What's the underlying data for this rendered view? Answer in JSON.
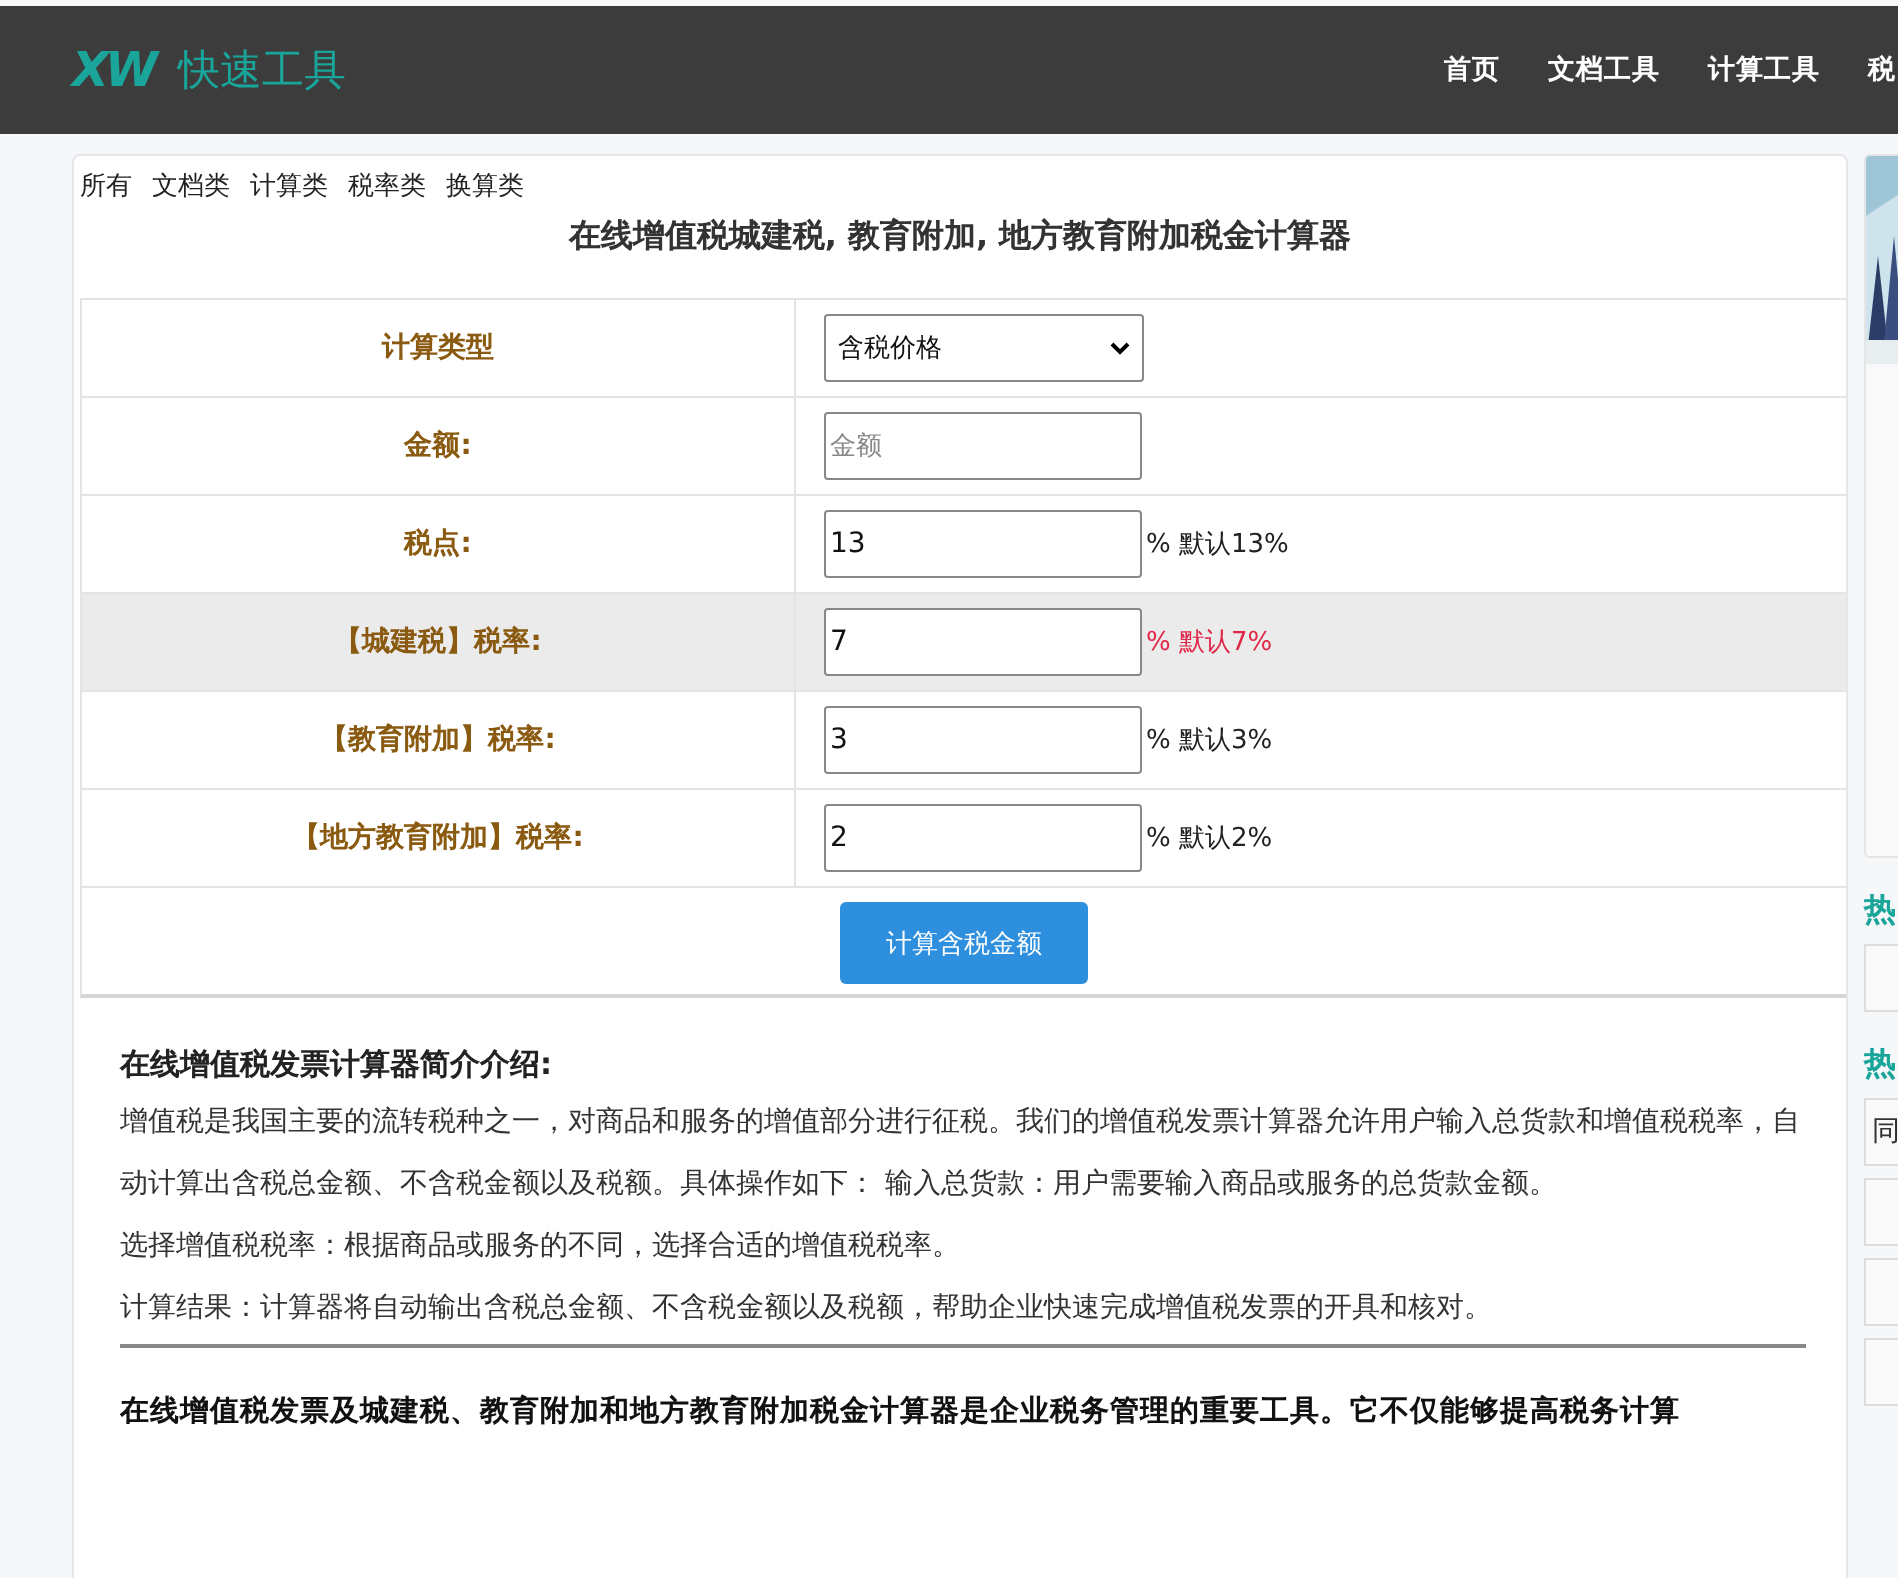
{
  "header": {
    "logo_mark": "XW",
    "logo_text": "快速工具",
    "nav": [
      "首页",
      "文档工具",
      "计算工具",
      "税"
    ]
  },
  "filters": [
    "所有",
    "文档类",
    "计算类",
    "税率类",
    "换算类"
  ],
  "title": "在线增值税城建税, 教育附加, 地方教育附加税金计算器",
  "form": [
    {
      "kind": "select",
      "label": "计算类型",
      "value": "含税价格",
      "highlighted": false
    },
    {
      "kind": "input",
      "label": "金额:",
      "placeholder": "金额",
      "highlighted": false
    },
    {
      "kind": "input",
      "label": "税点:",
      "value": "13",
      "note": "% 默认13%",
      "highlighted": false
    },
    {
      "kind": "input",
      "label": "【城建税】税率:",
      "value": "7",
      "note": "% 默认7%",
      "highlighted": true
    },
    {
      "kind": "input",
      "label": "【教育附加】税率:",
      "value": "3",
      "note": "% 默认3%",
      "highlighted": false
    },
    {
      "kind": "input",
      "label": "【地方教育附加】税率:",
      "value": "2",
      "note": "% 默认2%",
      "highlighted": false
    }
  ],
  "submit": "计算含税金额",
  "intro": {
    "heading": "在线增值税发票计算器简介介绍:",
    "paragraphs": [
      "增值税是我国主要的流转税种之一，对商品和服务的增值部分进行征税。我们的增值税发票计算器允许用户输入总货款和增值税税率，自动计算出含税总金额、不含税金额以及税额。具体操作如下： 输入总货款：用户需要输入商品或服务的总货款金额。",
      "选择增值税税率：根据商品或服务的不同，选择合适的增值税税率。",
      "计算结果：计算器将自动输出含税总金额、不含税金额以及税额，帮助企业快速完成增值税发票的开具和核对。"
    ],
    "summary": "在线增值税发票及城建税、教育附加和地方教育附加税金计算器是企业税务管理的重要工具。它不仅能够提高税务计算"
  },
  "sidebar": {
    "section_titles": [
      "热",
      "热"
    ],
    "list_items": [
      "同"
    ]
  }
}
